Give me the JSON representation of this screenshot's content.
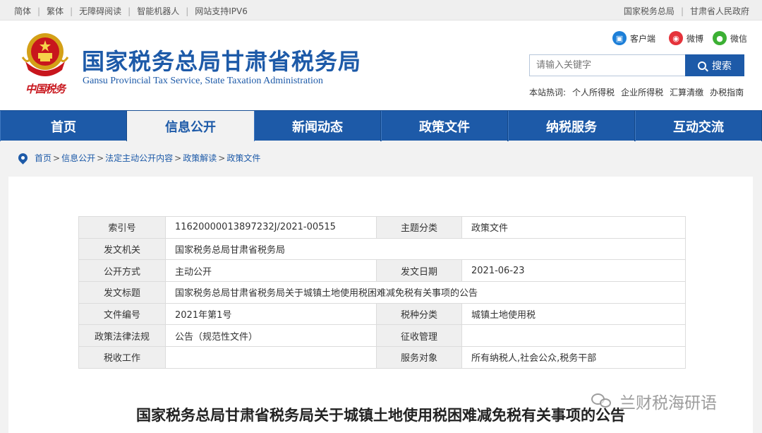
{
  "topbar": {
    "left_links": [
      "简体",
      "繁体",
      "无障碍阅读",
      "智能机器人",
      "网站支持IPV6"
    ],
    "right_links": [
      "国家税务总局",
      "甘肃省人民政府"
    ]
  },
  "header": {
    "logo_caption": "中国税务",
    "title": "国家税务总局甘肃省税务局",
    "subtitle": "Gansu Provincial Tax Service, State Taxation Administration",
    "social": {
      "client": "客户端",
      "weibo": "微博",
      "wechat": "微信"
    },
    "search": {
      "placeholder": "请输入关键字",
      "button": "搜索"
    },
    "hotwords_label": "本站热词:",
    "hotwords": [
      "个人所得税",
      "企业所得税",
      "汇算清缴",
      "办税指南"
    ]
  },
  "nav": {
    "items": [
      "首页",
      "信息公开",
      "新闻动态",
      "政策文件",
      "纳税服务",
      "互动交流"
    ],
    "active": "信息公开"
  },
  "breadcrumb": [
    "首页",
    "信息公开",
    "法定主动公开内容",
    "政策解读",
    "政策文件"
  ],
  "meta": {
    "index_label": "索引号",
    "index_value": "11620000013897232J/2021-00515",
    "topic_label": "主题分类",
    "topic_value": "政策文件",
    "issuer_label": "发文机关",
    "issuer_value": "国家税务总局甘肃省税务局",
    "mode_label": "公开方式",
    "mode_value": "主动公开",
    "date_label": "发文日期",
    "date_value": "2021-06-23",
    "title_label": "发文标题",
    "title_value": "国家税务总局甘肃省税务局关于城镇土地使用税困难减免税有关事项的公告",
    "docno_label": "文件编号",
    "docno_value": "2021年第1号",
    "taxtype_label": "税种分类",
    "taxtype_value": "城镇土地使用税",
    "law_label": "政策法律法规",
    "law_value": "公告（规范性文件）",
    "collect_label": "征收管理",
    "collect_value": "",
    "work_label": "税收工作",
    "work_value": "",
    "target_label": "服务对象",
    "target_value": "所有纳税人,社会公众,税务干部"
  },
  "article": {
    "title": "国家税务总局甘肃省税务局关于城镇土地使用税困难减免税有关事项的公告"
  },
  "watermark": "兰财税海研语",
  "colors": {
    "brand_blue": "#1d5aa8",
    "emblem_red": "#c8161d"
  }
}
